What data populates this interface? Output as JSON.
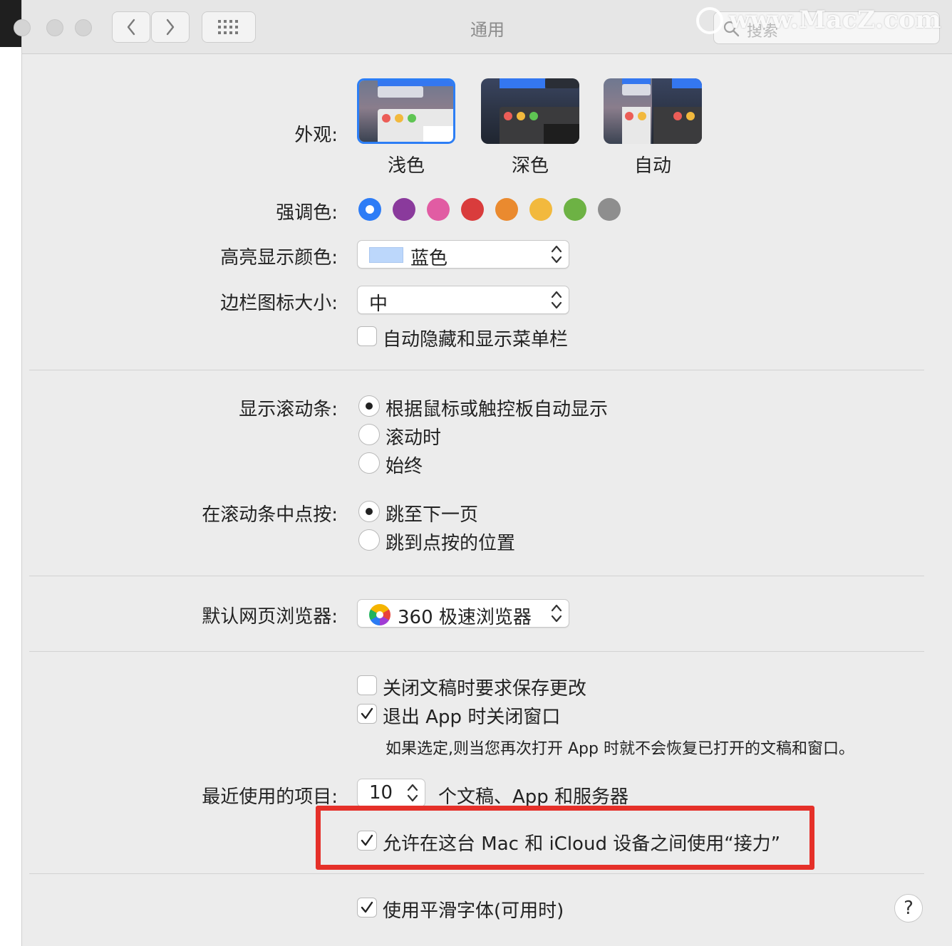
{
  "window": {
    "title": "通用",
    "search_placeholder": "搜索",
    "watermark": "www.MacZ.com"
  },
  "appearance": {
    "label": "外观:",
    "options": [
      {
        "label": "浅色"
      },
      {
        "label": "深色"
      },
      {
        "label": "自动"
      }
    ],
    "selected": "浅色"
  },
  "accent": {
    "label": "强调色:",
    "colors": [
      "#2d7cf6",
      "#8a3a9c",
      "#e15ca3",
      "#d93c3c",
      "#ea8a2f",
      "#f2b93d",
      "#6db244",
      "#8e8e8e"
    ],
    "selected_index": 0
  },
  "highlight": {
    "label": "高亮显示颜色:",
    "value": "蓝色",
    "swatch_color": "#bcd7fb"
  },
  "sidebar_icon": {
    "label": "边栏图标大小:",
    "value": "中"
  },
  "menubar": {
    "label": "自动隐藏和显示菜单栏",
    "checked": false
  },
  "scrollbars": {
    "label": "显示滚动条:",
    "options": [
      "根据鼠标或触控板自动显示",
      "滚动时",
      "始终"
    ],
    "selected_index": 0
  },
  "click_scroll": {
    "label": "在滚动条中点按:",
    "options": [
      "跳至下一页",
      "跳到点按的位置"
    ],
    "selected_index": 0
  },
  "browser": {
    "label": "默认网页浏览器:",
    "value": "360 极速浏览器"
  },
  "documents": {
    "ask_save": {
      "label": "关闭文稿时要求保存更改",
      "checked": false
    },
    "close_windows": {
      "label": "退出 App 时关闭窗口",
      "checked": true
    },
    "close_windows_note": "如果选定,则当您再次打开 App 时就不会恢复已打开的文稿和窗口。"
  },
  "recent": {
    "label": "最近使用的项目:",
    "value": "10",
    "suffix": "个文稿、App 和服务器"
  },
  "handoff": {
    "label": "允许在这台 Mac 和 iCloud 设备之间使用“接力”",
    "checked": true
  },
  "font_smoothing": {
    "label": "使用平滑字体(可用时)",
    "checked": true
  },
  "help": {
    "label": "?"
  }
}
